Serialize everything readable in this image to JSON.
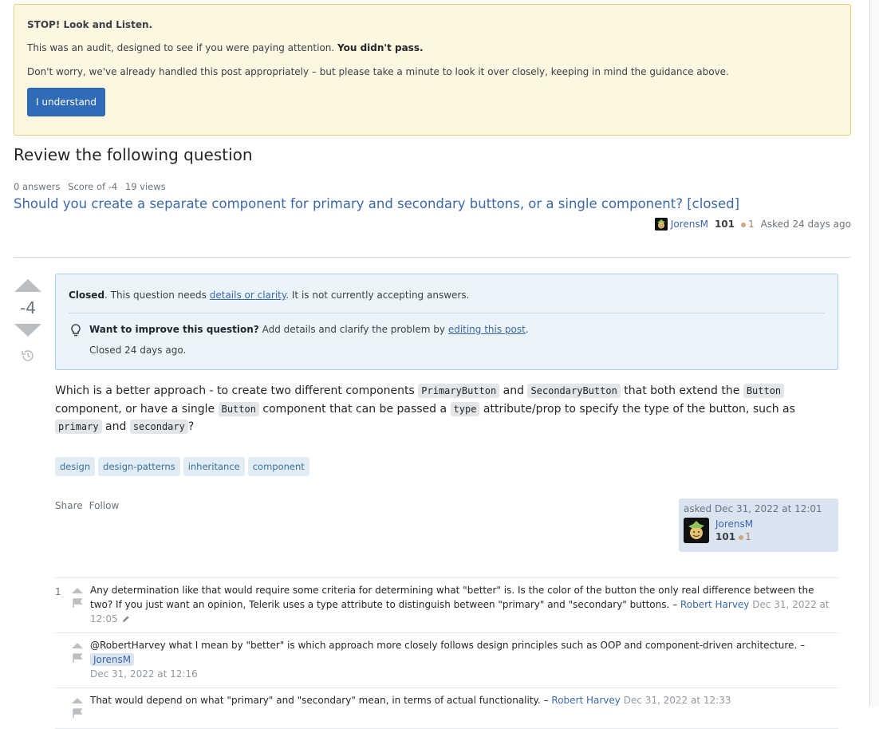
{
  "audit": {
    "title": "STOP! Look and Listen.",
    "line1_prefix": "This was an audit, designed to see if you were paying attention. ",
    "line1_bold": "You didn't pass.",
    "line2": "Don't worry, we've already handled this post appropriately – but please take a minute to look it over closely, keeping in mind the guidance above.",
    "button_label": "I understand"
  },
  "review": {
    "heading": "Review the following question",
    "stats": {
      "answers": "0 answers",
      "score": "Score of -4",
      "views": "19 views"
    },
    "question_title": "Should you create a separate component for primary and secondary buttons, or a single component? [closed]",
    "owner": {
      "name": "JorensM",
      "reputation": "101",
      "bronze_badges": "1",
      "asked": "Asked 24 days ago"
    }
  },
  "post": {
    "vote_count": "-4",
    "closed_notice": {
      "bold": "Closed",
      "text_before_link": ". This question needs ",
      "link": "details or clarity",
      "text_after_link": ". It is not currently accepting answers.",
      "improve_bold": "Want to improve this question?",
      "improve_text": " Add details and clarify the problem by ",
      "improve_link": "editing this post",
      "improve_end": ".",
      "closed_when": "Closed 24 days ago."
    },
    "body": {
      "t1": "Which is a better approach - to create two different components ",
      "c1": "PrimaryButton",
      "t2": " and ",
      "c2": "SecondaryButton",
      "t3": " that both extend the ",
      "c3": "Button",
      "t4": " component, or have a single ",
      "c4": "Button",
      "t5": " component that can be passed a ",
      "c5": "type",
      "t6": " attribute/prop to specify the type of the button, such as ",
      "c6": "primary",
      "t7": " and ",
      "c7": "secondary",
      "t8": "?"
    },
    "tags": [
      "design",
      "design-patterns",
      "inheritance",
      "component"
    ],
    "menu": {
      "share": "Share",
      "follow": "Follow"
    },
    "user_card": {
      "asked": "asked Dec 31, 2022 at 12:01",
      "name": "JorensM",
      "reputation": "101",
      "bronze_badges": "1"
    }
  },
  "comments": [
    {
      "score": "1",
      "text": "Any determination like that would require some criteria for determining what \"better\" is. Is the color of the button the only real difference between the two? If you just want an opinion, Telerik uses a type attribute to distinguish between \"primary\" and \"secondary\" buttons.",
      "sep": " – ",
      "author": "Robert Harvey",
      "date": "Dec 31, 2022 at 12:05",
      "edited": true
    },
    {
      "score": "",
      "text": "@RobertHarvey what I mean by \"better\" is which approach more closely follows design principles such as OOP and component-driven architecture.",
      "sep": " – ",
      "author": "JorensM",
      "date": "Dec 31, 2022 at 12:16",
      "edited": false
    },
    {
      "score": "",
      "text": "That would depend on what \"primary\" and \"secondary\" mean, in terms of actual functionality.",
      "sep": " – ",
      "author": "Robert Harvey",
      "date": "Dec 31, 2022 at 12:33",
      "edited": false
    }
  ],
  "colors": {
    "primary_button": "#2f6bb7",
    "link": "#3b68a9",
    "audit_bg": "#fdf7e2",
    "closed_bg": "#ebf4fb",
    "tag_bg": "#e1ecf4"
  }
}
